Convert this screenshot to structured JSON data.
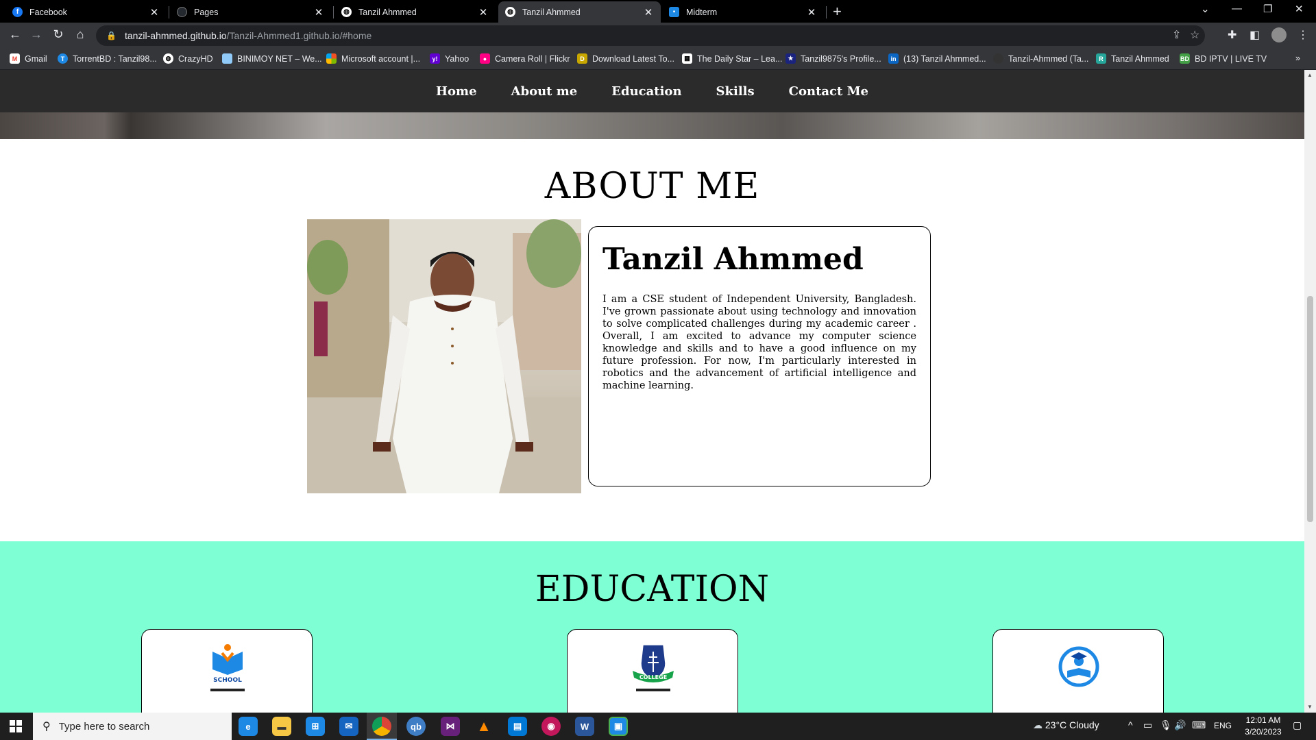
{
  "browser": {
    "tabs": [
      {
        "title": "Facebook",
        "icon": "facebook-icon"
      },
      {
        "title": "Pages",
        "icon": "github-icon"
      },
      {
        "title": "Tanzil Ahmmed",
        "icon": "globe-icon"
      },
      {
        "title": "Tanzil Ahmmed",
        "icon": "globe-icon",
        "active": true
      },
      {
        "title": "Midterm",
        "icon": "classroom-icon"
      }
    ],
    "url_host": "tanzil-ahmmed.github.io",
    "url_path": "/Tanzil-Ahmmed1.github.io/#home",
    "bookmarks": [
      {
        "label": "Gmail",
        "color": "#ea4335"
      },
      {
        "label": "TorrentBD : Tanzil98...",
        "color": "#1e88e5"
      },
      {
        "label": "CrazyHD",
        "color": "#9e9e9e"
      },
      {
        "label": "BINIMOY NET – We...",
        "color": "#90caf9"
      },
      {
        "label": "Microsoft account |...",
        "color": "#f25022"
      },
      {
        "label": "Yahoo",
        "color": "#6001d2"
      },
      {
        "label": "Camera Roll | Flickr",
        "color": "#ff0084"
      },
      {
        "label": "Download Latest To...",
        "color": "#c8a600"
      },
      {
        "label": "The Daily Star – Lea...",
        "color": "#ffffff"
      },
      {
        "label": "Tanzil9875's Profile...",
        "color": "#1a237e"
      },
      {
        "label": "(13) Tanzil Ahmmed...",
        "color": "#0a66c2"
      },
      {
        "label": "Tanzil-Ahmmed (Ta...",
        "color": "#333333"
      },
      {
        "label": "Tanzil Ahmmed",
        "color": "#26a69a"
      },
      {
        "label": "BD IPTV | LIVE TV",
        "color": "#43a047"
      }
    ]
  },
  "nav": {
    "items": [
      "Home",
      "About me",
      "Education",
      "Skills",
      "Contact Me"
    ]
  },
  "about": {
    "title": "ABOUT ME",
    "name": "Tanzil Ahmmed",
    "bio": "I am a CSE student of Independent University, Bangladesh. I've grown passionate about using technology and innovation to solve complicated challenges during my academic career . Overall, I am excited to advance my computer science knowledge and skills and to have a good influence on my future profession. For now, I'm particularly interested in robotics and the advancement of artificial intelligence and machine learning."
  },
  "education": {
    "title": "EDUCATION",
    "cards": [
      {
        "logo": "school-logo-icon",
        "logo_text": "SCHOOL"
      },
      {
        "logo": "college-logo-icon",
        "logo_text": "COLLEGE"
      },
      {
        "logo": "university-logo-icon"
      }
    ]
  },
  "taskbar": {
    "search_placeholder": "Type here to search",
    "weather": "23°C  Cloudy",
    "language": "ENG",
    "time": "12:01 AM",
    "date": "3/20/2023"
  },
  "colors": {
    "navbar_bg": "#2b2b2b",
    "education_bg": "#7fffd4",
    "chrome_dark": "#35363a"
  }
}
